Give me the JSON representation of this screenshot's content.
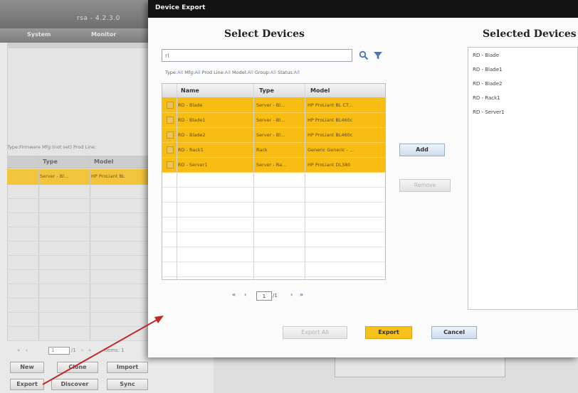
{
  "background_app": {
    "title": "rsa - 4.2.3.0",
    "menu": [
      "System",
      "Monitor"
    ],
    "filter_text": "Type:Firmware Mfg:(not set) Prod Line:",
    "columns": [
      "Type",
      "Model"
    ],
    "selected_row": [
      "Server - Bl...",
      "HP ProLiant BL "
    ],
    "pager": {
      "page": "1",
      "total": "/1",
      "per_page": "Items: 1"
    },
    "buttons": {
      "new": "New",
      "clone": "Clone",
      "import": "Import",
      "export": "Export",
      "discover": "Discover",
      "sync": "Sync"
    }
  },
  "dialog": {
    "title": "Device Export",
    "select_heading": "Select Devices",
    "selected_heading": "Selected Devices",
    "search": {
      "value": "rl",
      "placeholder": ""
    },
    "filters": [
      {
        "label": "Type:",
        "value": "All"
      },
      {
        "label": "Mfg:",
        "value": "All"
      },
      {
        "label": "Prod Line:",
        "value": "All"
      },
      {
        "label": "Model:",
        "value": "All"
      },
      {
        "label": "Group:",
        "value": "All"
      },
      {
        "label": "Status:",
        "value": "All"
      }
    ],
    "table": {
      "columns": [
        "Name",
        "Type",
        "Model"
      ],
      "rows": [
        {
          "name": "RD - Blade",
          "type": "Server - Bl...",
          "model": "HP ProLiant BL CT..."
        },
        {
          "name": "RD - Blade1",
          "type": "Server - Bl...",
          "model": "HP ProLiant BL460c"
        },
        {
          "name": "RD - Blade2",
          "type": "Server - Bl...",
          "model": "HP ProLiant BL460c"
        },
        {
          "name": "RD - Rack1",
          "type": "Rack",
          "model": "Generic Generic - ..."
        },
        {
          "name": "RD - Server1",
          "type": "Server - Ra...",
          "model": "HP ProLiant DL380"
        }
      ]
    },
    "pager": {
      "page": "1",
      "total": "/1"
    },
    "add_label": "Add",
    "remove_label": "Remove",
    "selected_devices": [
      "RD - Blade",
      "RD - Blade1",
      "RD - Blade2",
      "RD - Rack1",
      "RD - Server1"
    ],
    "export_all_label": "Export All",
    "export_label": "Export",
    "cancel_label": "Cancel"
  },
  "icons": {
    "search": "search-icon",
    "filter": "filter-icon",
    "pager": [
      "first-page-icon",
      "prev-page-icon",
      "next-page-icon",
      "last-page-icon"
    ]
  },
  "colors": {
    "selection": "#f7bd12",
    "export_button": "#f7c21a",
    "annotation_arrow": "#c0282a",
    "title_bar": "#131313"
  }
}
